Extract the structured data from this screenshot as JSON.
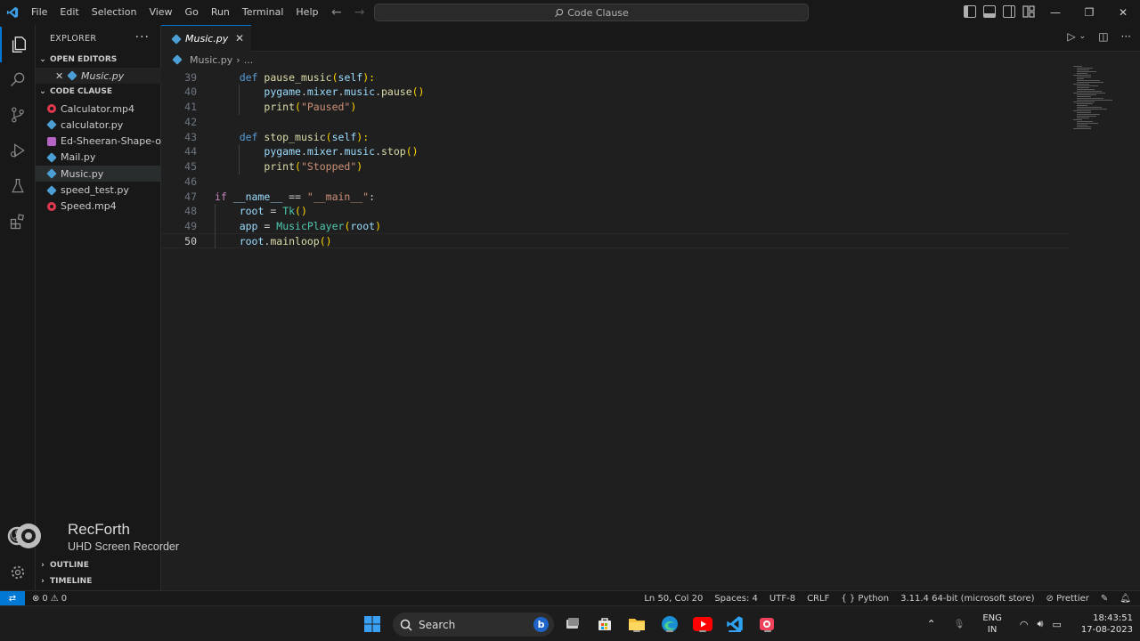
{
  "menu": [
    "File",
    "Edit",
    "Selection",
    "View",
    "Go",
    "Run",
    "Terminal",
    "Help"
  ],
  "command_center": "Code Clause",
  "explorer": {
    "title": "EXPLORER",
    "more": "···",
    "open_editors_label": "OPEN EDITORS",
    "open_editor_file": "Music.py",
    "folder_label": "CODE CLAUSE",
    "files": [
      {
        "name": "Calculator.mp4",
        "type": "mp4"
      },
      {
        "name": "calculator.py",
        "type": "py"
      },
      {
        "name": "Ed-Sheeran-Shape-of...",
        "type": "mp3"
      },
      {
        "name": "Mail.py",
        "type": "py"
      },
      {
        "name": "Music.py",
        "type": "py",
        "selected": true
      },
      {
        "name": "speed_test.py",
        "type": "py"
      },
      {
        "name": "Speed.mp4",
        "type": "mp4"
      }
    ],
    "outline_label": "OUTLINE",
    "timeline_label": "TIMELINE"
  },
  "tab": {
    "label": "Music.py",
    "close": "✕"
  },
  "breadcrumb": {
    "file": "Music.py",
    "sep": "›",
    "rest": "..."
  },
  "code_lines": [
    {
      "n": "39",
      "tokens": [
        [
          "    ",
          ""
        ],
        [
          "def ",
          "kw"
        ],
        [
          "pause_music",
          "fn"
        ],
        [
          "(",
          "par"
        ],
        [
          "self",
          "var"
        ],
        [
          "):",
          "par"
        ]
      ]
    },
    {
      "n": "40",
      "tokens": [
        [
          "        ",
          ""
        ],
        [
          "pygame",
          "var"
        ],
        [
          ".",
          ""
        ],
        [
          "mixer",
          "var"
        ],
        [
          ".",
          ""
        ],
        [
          "music",
          "var"
        ],
        [
          ".",
          ""
        ],
        [
          "pause",
          "fn"
        ],
        [
          "()",
          "par"
        ]
      ]
    },
    {
      "n": "41",
      "tokens": [
        [
          "        ",
          ""
        ],
        [
          "print",
          "fn"
        ],
        [
          "(",
          "par"
        ],
        [
          "\"Paused\"",
          "str"
        ],
        [
          ")",
          "par"
        ]
      ]
    },
    {
      "n": "42",
      "tokens": []
    },
    {
      "n": "43",
      "tokens": [
        [
          "    ",
          ""
        ],
        [
          "def ",
          "kw"
        ],
        [
          "stop_music",
          "fn"
        ],
        [
          "(",
          "par"
        ],
        [
          "self",
          "var"
        ],
        [
          "):",
          "par"
        ]
      ]
    },
    {
      "n": "44",
      "tokens": [
        [
          "        ",
          ""
        ],
        [
          "pygame",
          "var"
        ],
        [
          ".",
          ""
        ],
        [
          "mixer",
          "var"
        ],
        [
          ".",
          ""
        ],
        [
          "music",
          "var"
        ],
        [
          ".",
          ""
        ],
        [
          "stop",
          "fn"
        ],
        [
          "()",
          "par"
        ]
      ]
    },
    {
      "n": "45",
      "tokens": [
        [
          "        ",
          ""
        ],
        [
          "print",
          "fn"
        ],
        [
          "(",
          "par"
        ],
        [
          "\"Stopped\"",
          "str"
        ],
        [
          ")",
          "par"
        ]
      ]
    },
    {
      "n": "46",
      "tokens": []
    },
    {
      "n": "47",
      "tokens": [
        [
          "if ",
          "kw2"
        ],
        [
          "__name__",
          "var"
        ],
        [
          " == ",
          ""
        ],
        [
          "\"__main__\"",
          "str"
        ],
        [
          ":",
          ""
        ]
      ]
    },
    {
      "n": "48",
      "tokens": [
        [
          "    ",
          ""
        ],
        [
          "root",
          "var"
        ],
        [
          " = ",
          ""
        ],
        [
          "Tk",
          "cls"
        ],
        [
          "()",
          "par"
        ]
      ]
    },
    {
      "n": "49",
      "tokens": [
        [
          "    ",
          ""
        ],
        [
          "app",
          "var"
        ],
        [
          " = ",
          ""
        ],
        [
          "MusicPlayer",
          "cls"
        ],
        [
          "(",
          "par"
        ],
        [
          "root",
          "var"
        ],
        [
          ")",
          "par"
        ]
      ]
    },
    {
      "n": "50",
      "tokens": [
        [
          "    ",
          ""
        ],
        [
          "root",
          "var"
        ],
        [
          ".",
          ""
        ],
        [
          "mainloop",
          "fn"
        ],
        [
          "()",
          "par"
        ]
      ],
      "current": true
    }
  ],
  "watermark": {
    "title": "RecForth",
    "subtitle": "UHD Screen Recorder"
  },
  "status": {
    "errors": "0",
    "warnings": "0",
    "position": "Ln 50, Col 20",
    "spaces": "Spaces: 4",
    "encoding": "UTF-8",
    "eol": "CRLF",
    "language": "Python",
    "interpreter": "3.11.4 64-bit (microsoft store)",
    "prettier": "Prettier"
  },
  "taskbar": {
    "search": "Search",
    "lang_line1": "ENG",
    "lang_line2": "IN",
    "time": "18:43:51",
    "date": "17-08-2023"
  }
}
